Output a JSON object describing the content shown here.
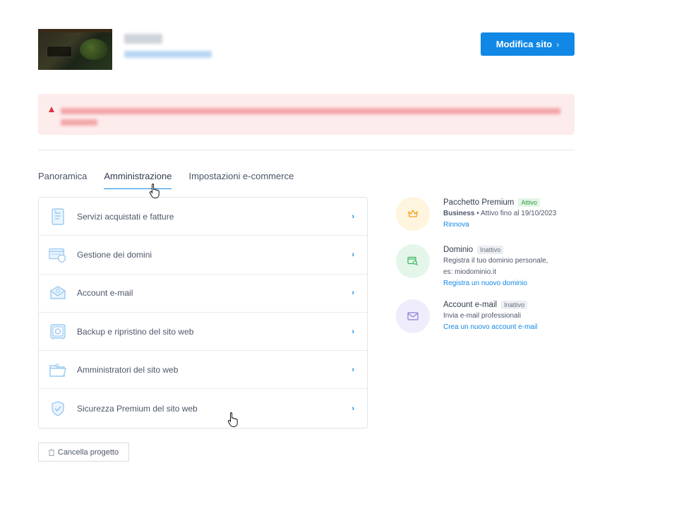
{
  "header": {
    "edit_site_label": "Modifica sito",
    "edit_site_chevron": "›"
  },
  "tabs": [
    {
      "label": "Panoramica"
    },
    {
      "label": "Amministrazione",
      "active": true
    },
    {
      "label": "Impostazioni e-commerce"
    }
  ],
  "menu": [
    {
      "label": "Servizi acquistati e fatture",
      "icon": "invoice-icon"
    },
    {
      "label": "Gestione dei domini",
      "icon": "domain-shield-icon"
    },
    {
      "label": "Account e-mail",
      "icon": "email-icon"
    },
    {
      "label": "Backup e ripristino del sito web",
      "icon": "safe-icon"
    },
    {
      "label": "Amministratori del sito web",
      "icon": "folder-user-icon"
    },
    {
      "label": "Sicurezza Premium del sito web",
      "icon": "shield-check-icon"
    }
  ],
  "menu_arrow": "›",
  "side": {
    "premium": {
      "title": "Pacchetto Premium",
      "badge": "Attivo",
      "plan": "Business",
      "separator": "•",
      "status_text": "Attivo fino al 19/10/2023",
      "link": "Rinnova",
      "icon": "crown-icon",
      "color": "#f2a31a"
    },
    "domain": {
      "title": "Dominio",
      "badge": "Inattivo",
      "line1": "Registra il tuo dominio personale,",
      "line2": "es: miodominio.it",
      "link": "Registra un nuovo dominio",
      "icon": "domain-search-icon",
      "color": "#3bb55e"
    },
    "email": {
      "title": "Account e-mail",
      "badge": "Inattivo",
      "line1": "Invia e-mail professionali",
      "link": "Crea un nuovo account e-mail",
      "icon": "envelope-icon",
      "color": "#8b7fd6"
    }
  },
  "footer": {
    "cancel_label": "Cancella progetto",
    "icon": "trash-icon"
  },
  "colors": {
    "accent": "#1188e6",
    "alert_bg": "#fdecec",
    "alert_icon": "#d9363e"
  }
}
